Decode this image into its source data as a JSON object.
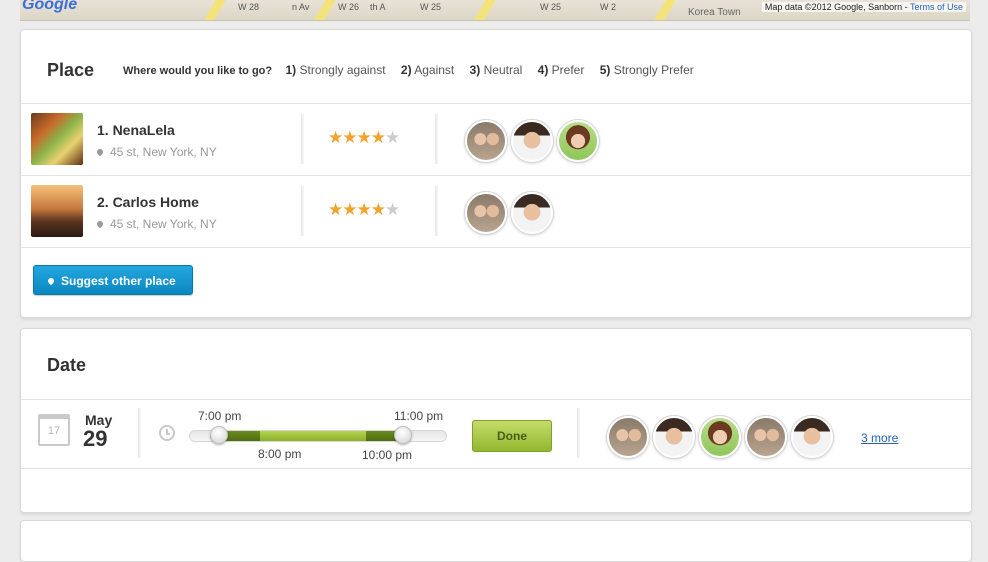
{
  "map": {
    "logo": "Google",
    "streets": [
      "n Av",
      "W 28",
      "W 26",
      "W 25",
      "th A",
      "W 25",
      "W 2"
    ],
    "area_label": "Korea Town",
    "attribution": "Map data ©2012 Google, Sanborn -",
    "terms_link": "Terms of Use"
  },
  "place": {
    "title": "Place",
    "question": "Where would you like to go?",
    "options": [
      {
        "num": "1)",
        "label": "Strongly against"
      },
      {
        "num": "2)",
        "label": "Against"
      },
      {
        "num": "3)",
        "label": "Neutral"
      },
      {
        "num": "4)",
        "label": "Prefer"
      },
      {
        "num": "5)",
        "label": "Strongly Prefer"
      }
    ],
    "items": [
      {
        "name": "1. NenaLela",
        "address": "45 st, New York, NY",
        "rating": 4,
        "max_rating": 5,
        "thumb": "sushi-photo",
        "avatars": [
          "two-women",
          "smiling-man",
          "woman-green"
        ]
      },
      {
        "name": "2. Carlos Home",
        "address": "45 st, New York, NY",
        "rating": 4,
        "max_rating": 5,
        "thumb": "bridge-photo",
        "avatars": [
          "two-women",
          "smiling-man"
        ]
      }
    ],
    "suggest_label": "Suggest other place"
  },
  "date": {
    "title": "Date",
    "calendar_icon_day": "17",
    "month": "May",
    "day": "29",
    "range_start": "7:00 pm",
    "range_end": "11:00 pm",
    "selected_start": "8:00 pm",
    "selected_end": "10:00 pm",
    "done_label": "Done",
    "avatars": [
      "two-women",
      "smiling-man",
      "woman-green",
      "two-women",
      "smiling-man"
    ],
    "more_label": "3 more"
  },
  "colors": {
    "accent_blue": "#0b87c2",
    "done_green": "#93b72f",
    "star": "#f2a32b",
    "link": "#2a63b8"
  }
}
